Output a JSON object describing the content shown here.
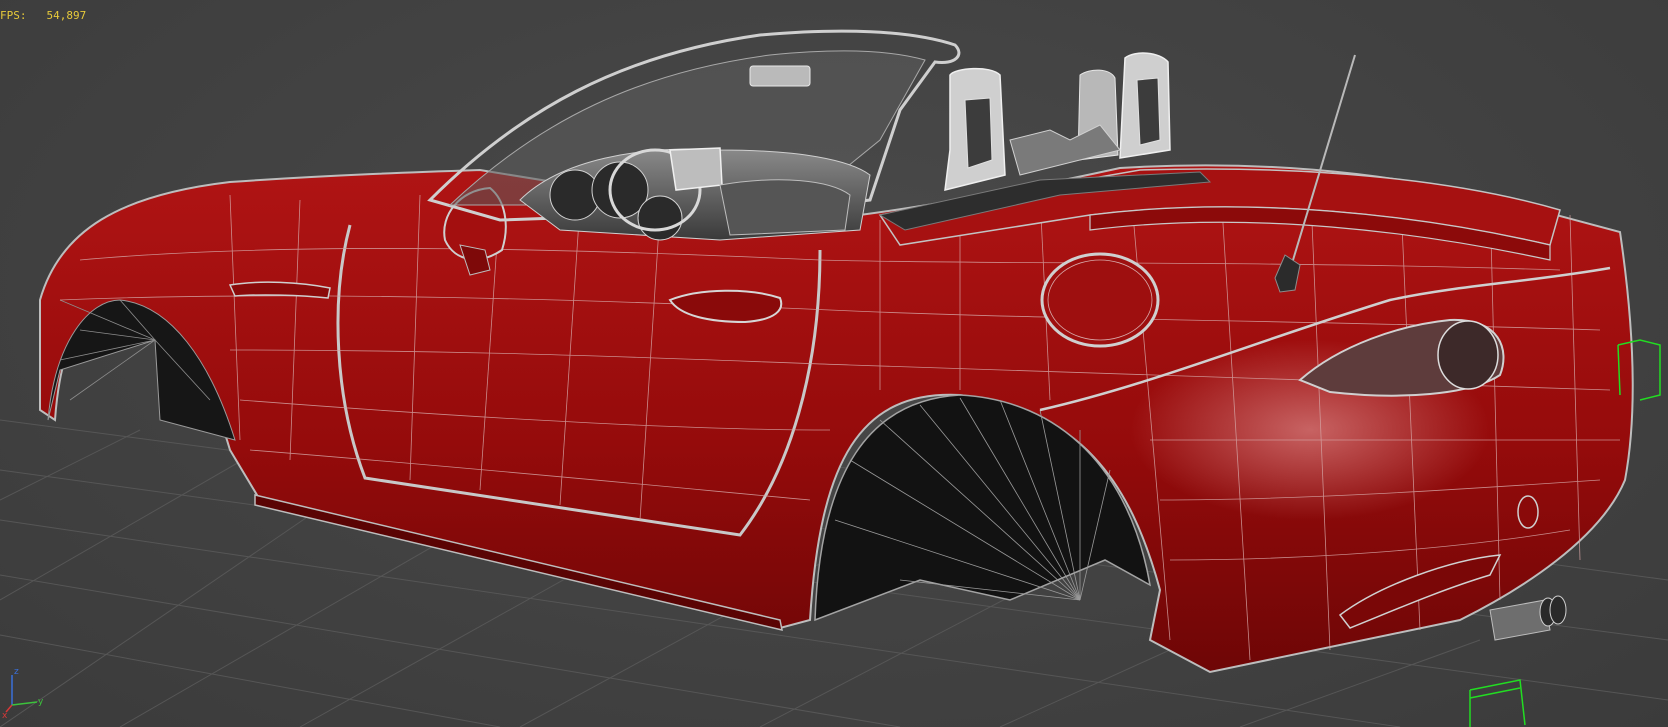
{
  "viewport": {
    "fps_label": "FPS:",
    "fps_value": "54,897"
  },
  "axis_gizmo": {
    "x": "x",
    "y": "y",
    "z": "z"
  },
  "colors": {
    "background": "#444444",
    "grid": "#5a5a5a",
    "body_red": "#9b0d0d",
    "body_dark_red": "#6b0606",
    "wireframe": "#d9b0b0",
    "interior": "#cfcfcf",
    "wheel_arch": "#1a1a1a",
    "fps_text": "#e6c93a",
    "selection": "#22dd22"
  }
}
